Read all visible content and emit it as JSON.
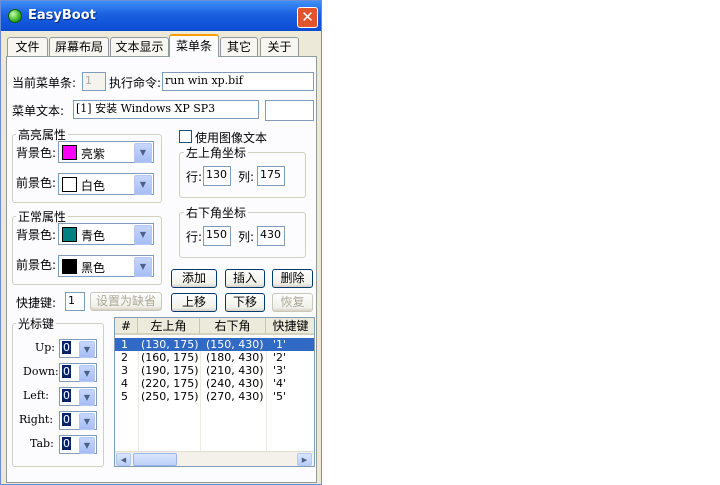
{
  "window": {
    "title": "EasyBoot",
    "close_glyph": "✕",
    "icon": "app-icon"
  },
  "tabs": [
    {
      "label": "文件"
    },
    {
      "label": "屏幕布局"
    },
    {
      "label": "文本显示"
    },
    {
      "label": "菜单条",
      "active": true
    },
    {
      "label": "其它"
    },
    {
      "label": "关于"
    }
  ],
  "menu": {
    "current_label": "当前菜单条:",
    "current_value": "1",
    "command_label": "执行命令:",
    "command_value": "run win xp.bif",
    "text_label": "菜单文本:",
    "text_value": "[1] 安装 Windows XP SP3",
    "extra_value": ""
  },
  "highlight": {
    "title": "高亮属性",
    "bg_label": "背景色:",
    "bg_value": "亮紫",
    "bg_color": "#ff00ff",
    "fg_label": "前景色:",
    "fg_value": "白色",
    "fg_color": "#ffffff"
  },
  "normal": {
    "title": "正常属性",
    "bg_label": "背景色:",
    "bg_value": "青色",
    "bg_color": "#008080",
    "fg_label": "前景色:",
    "fg_value": "黑色",
    "fg_color": "#000000"
  },
  "image_text": {
    "label": "使用图像文本",
    "checked": false
  },
  "top_left": {
    "title": "左上角坐标",
    "row_label": "行:",
    "row_value": "130",
    "col_label": "列:",
    "col_value": "175"
  },
  "bottom_right": {
    "title": "右下角坐标",
    "row_label": "行:",
    "row_value": "150",
    "col_label": "列:",
    "col_value": "430"
  },
  "buttons": {
    "add": "添加",
    "insert": "插入",
    "delete": "删除",
    "up": "上移",
    "down": "下移",
    "restore": "恢复",
    "set_default": "设置为缺省"
  },
  "hotkey": {
    "label": "快捷键:",
    "value": "1"
  },
  "cursor_keys": {
    "title": "光标键",
    "items": [
      {
        "label": "Up:",
        "value": "0"
      },
      {
        "label": "Down:",
        "value": "0"
      },
      {
        "label": "Left:",
        "value": "0"
      },
      {
        "label": "Right:",
        "value": "0"
      },
      {
        "label": "Tab:",
        "value": "0"
      }
    ]
  },
  "list": {
    "headers": [
      "#",
      "左上角",
      "右下角",
      "快捷键"
    ],
    "rows": [
      {
        "n": "1",
        "tl": "(130, 175)",
        "br": "(150, 430)",
        "key": "'1'"
      },
      {
        "n": "2",
        "tl": "(160, 175)",
        "br": "(180, 430)",
        "key": "'2'"
      },
      {
        "n": "3",
        "tl": "(190, 175)",
        "br": "(210, 430)",
        "key": "'3'"
      },
      {
        "n": "4",
        "tl": "(220, 175)",
        "br": "(240, 430)",
        "key": "'4'"
      },
      {
        "n": "5",
        "tl": "(250, 175)",
        "br": "(270, 430)",
        "key": "'5'"
      }
    ],
    "selected_index": 0
  },
  "colors": {
    "titlebar": "#0a4cd2",
    "selection": "#316ac5",
    "tab_accent": "#ff9c00"
  }
}
